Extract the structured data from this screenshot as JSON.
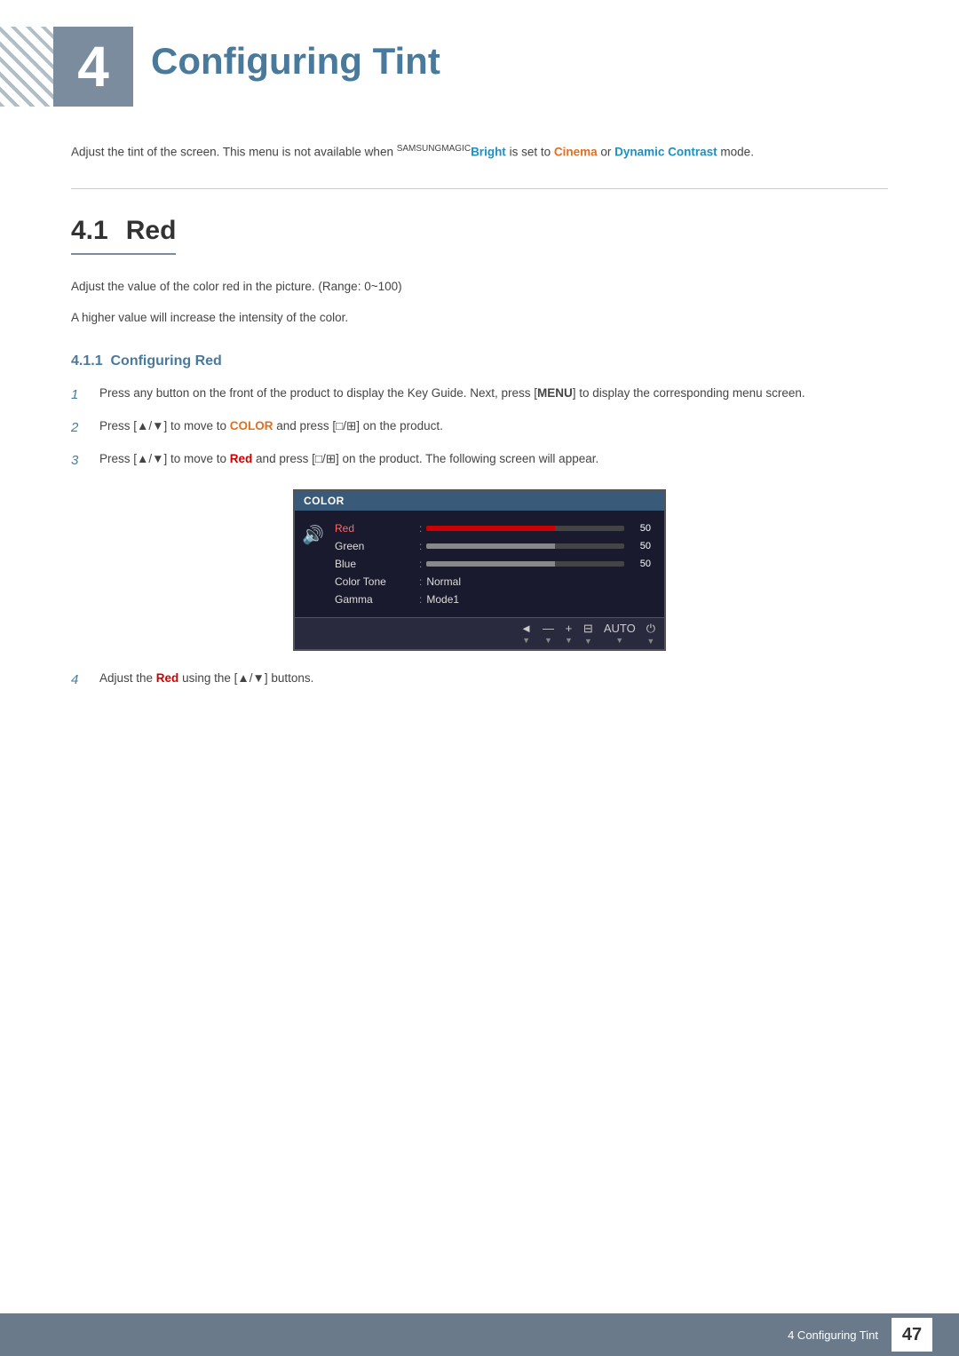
{
  "chapter": {
    "number": "4",
    "title": "Configuring Tint",
    "description_part1": "Adjust the tint of the screen. This menu is not available when ",
    "brand_label": "SAMSUNG",
    "magic_label": "MAGIC",
    "bright_label": "Bright",
    "description_part2": " is set to ",
    "cinema_label": "Cinema",
    "description_part3": " or ",
    "dynamic_contrast_label": "Dynamic Contrast",
    "description_part4": " mode."
  },
  "section_41": {
    "number": "4.1",
    "title": "Red",
    "body1": "Adjust the value of the color red in the picture. (Range: 0~100)",
    "body2": "A higher value will increase the intensity of the color."
  },
  "subsection_411": {
    "number": "4.1.1",
    "title": "Configuring Red",
    "steps": [
      {
        "number": "1",
        "text_part1": "Press any button on the front of the product to display the Key Guide. Next, press [",
        "bold1": "MENU",
        "text_part2": "] to display the corresponding menu screen."
      },
      {
        "number": "2",
        "text_part1": "Press [▲/▼] to move to ",
        "bold1": "COLOR",
        "text_part2": " and press [□/⊞] on the product."
      },
      {
        "number": "3",
        "text_part1": "Press [▲/▼] to move to ",
        "bold1": "Red",
        "text_part2": " and press [□/⊞] on the product. The following screen will appear."
      },
      {
        "number": "4",
        "text_part1": "Adjust the ",
        "bold1": "Red",
        "text_part2": " using the [▲/▼] buttons."
      }
    ]
  },
  "monitor": {
    "title": "COLOR",
    "menu_items": [
      {
        "label": "Red",
        "type": "slider",
        "color": "red",
        "value": "50",
        "active": true
      },
      {
        "label": "Green",
        "type": "slider",
        "color": "gray",
        "value": "50",
        "active": false
      },
      {
        "label": "Blue",
        "type": "slider",
        "color": "gray",
        "value": "50",
        "active": false
      },
      {
        "label": "Color Tone",
        "type": "text",
        "value": "Normal",
        "active": false
      },
      {
        "label": "Gamma",
        "type": "text",
        "value": "Mode1",
        "active": false
      }
    ],
    "footer_buttons": [
      "◄",
      "—",
      "+",
      "⊟",
      "AUTO",
      "⏻"
    ]
  },
  "page_footer": {
    "chapter_text": "4 Configuring Tint",
    "page_number": "47"
  }
}
